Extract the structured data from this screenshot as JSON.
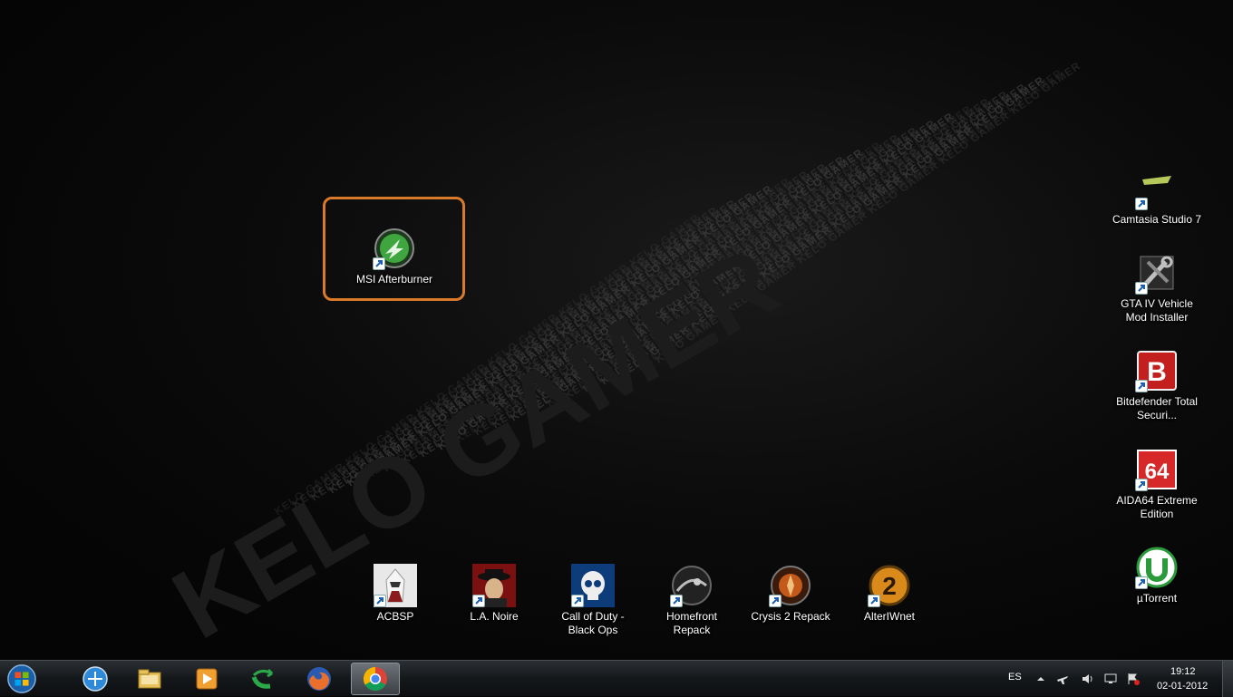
{
  "desktop": {
    "wallpaper_text": "KELO GAMER",
    "icons": [
      {
        "id": "msi-afterburner",
        "label": "MSI Afterburner"
      },
      {
        "id": "camtasia",
        "label": "Camtasia Studio 7"
      },
      {
        "id": "gta-iv",
        "label": "GTA IV Vehicle Mod Installer"
      },
      {
        "id": "bitdefender",
        "label": "Bitdefender Total Securi..."
      },
      {
        "id": "aida64",
        "label": "AIDA64 Extreme Edition"
      },
      {
        "id": "utorrent",
        "label": "µTorrent"
      },
      {
        "id": "acbsp",
        "label": "ACBSP"
      },
      {
        "id": "la-noire",
        "label": "L.A. Noire"
      },
      {
        "id": "cod-black-ops",
        "label": "Call of Duty - Black Ops"
      },
      {
        "id": "homefront",
        "label": "Homefront Repack"
      },
      {
        "id": "crysis2",
        "label": "Crysis 2 Repack"
      },
      {
        "id": "alteriwnet",
        "label": "AlterIWnet"
      }
    ],
    "highlight_color": "#d97a2b"
  },
  "taskbar": {
    "pinned": [
      "start-orb-icon",
      "connection-icon",
      "explorer-icon",
      "media-player-icon",
      "green-arrow-icon",
      "firefox-icon",
      "chrome-icon"
    ],
    "active_app": "chrome-icon",
    "tray": {
      "language": "ES",
      "time": "19:12",
      "date": "02-01-2012"
    }
  }
}
